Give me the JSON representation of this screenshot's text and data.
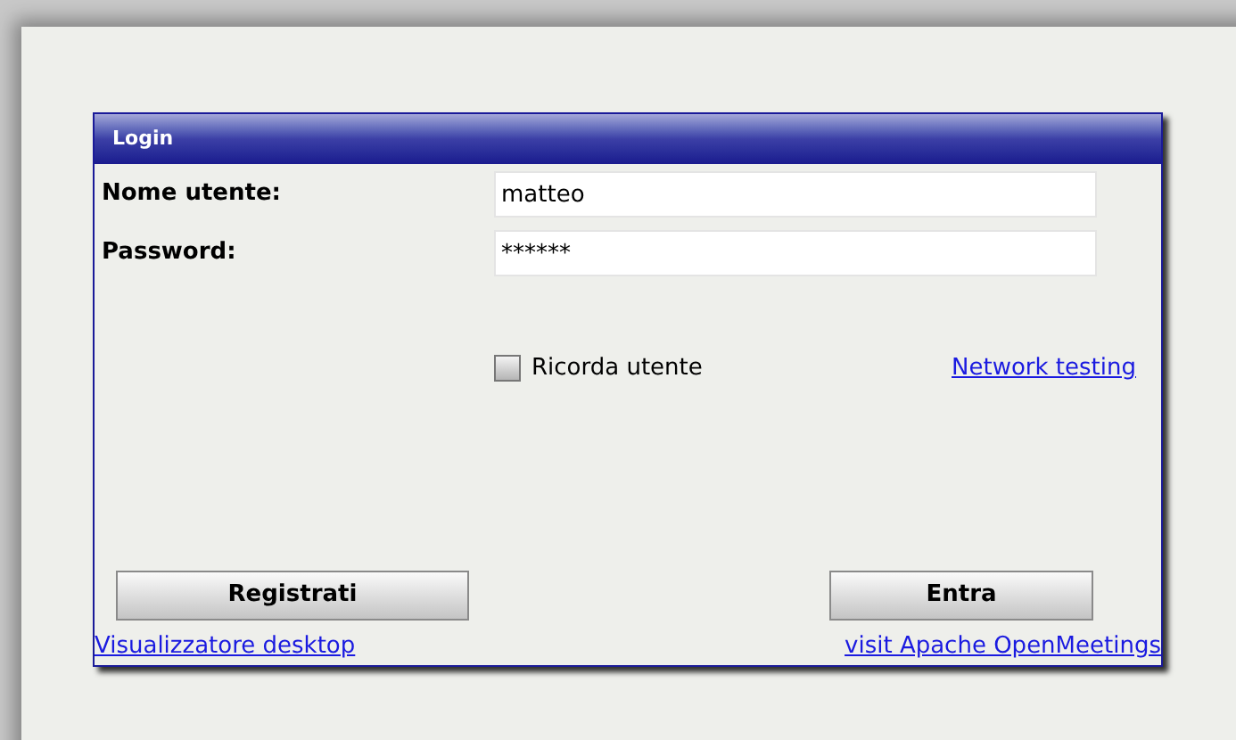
{
  "dialog": {
    "title": "Login"
  },
  "fields": [
    {
      "label": "Nome utente:",
      "value": "matteo"
    },
    {
      "label": "Password:",
      "value": "******"
    }
  ],
  "remember": {
    "label": "Ricorda utente",
    "checked": false
  },
  "network_link": "Network testing",
  "buttons": [
    {
      "label": "Registrati"
    },
    {
      "label": "Entra"
    }
  ],
  "footer_links": [
    "Visualizzatore desktop",
    "visit Apache OpenMeetings"
  ]
}
